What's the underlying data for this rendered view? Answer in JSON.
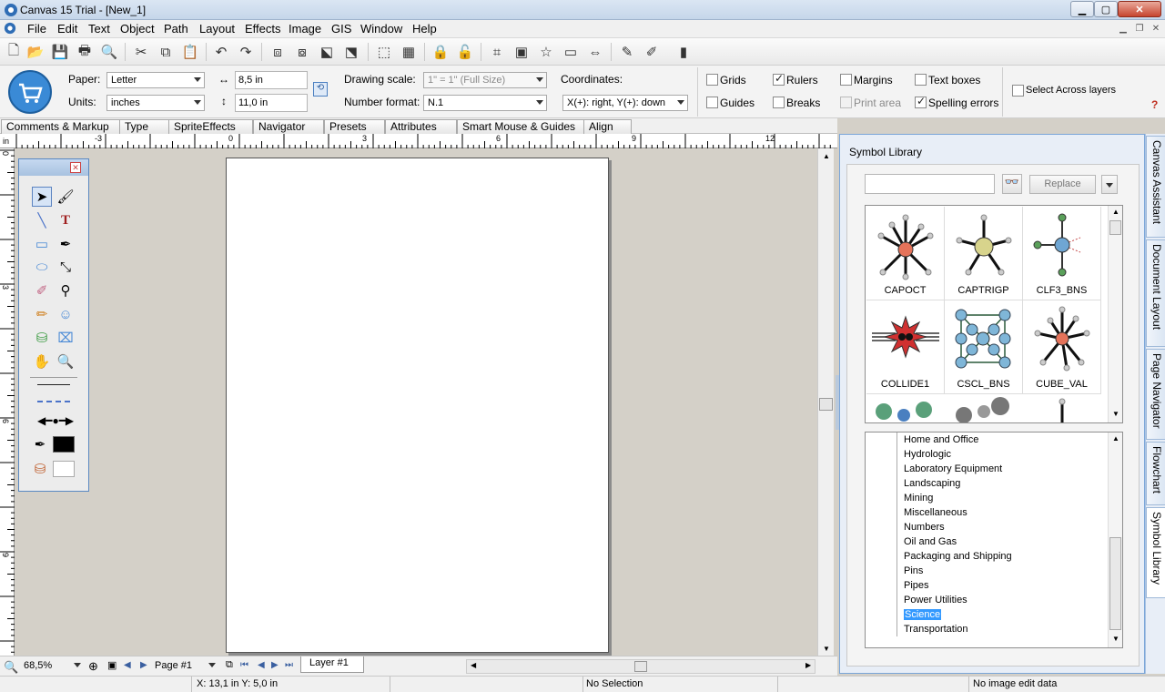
{
  "window": {
    "title": "Canvas 15 Trial - [New_1]"
  },
  "menu": [
    "File",
    "Edit",
    "Text",
    "Object",
    "Path",
    "Layout",
    "Effects",
    "Image",
    "GIS",
    "Window",
    "Help"
  ],
  "props": {
    "paper_label": "Paper:",
    "paper_value": "Letter",
    "units_label": "Units:",
    "units_value": "inches",
    "width_value": "8,5 in",
    "height_value": "11,0 in",
    "drawing_scale_label": "Drawing scale:",
    "drawing_scale_value": "1\" = 1\" (Full Size)",
    "number_format_label": "Number format:",
    "number_format_value": "N.1",
    "coordinates_label": "Coordinates:",
    "coordinates_value": "X(+): right, Y(+): down",
    "checks": {
      "grids": "Grids",
      "guides": "Guides",
      "rulers": "Rulers",
      "breaks": "Breaks",
      "margins": "Margins",
      "print_area": "Print area",
      "text_boxes": "Text boxes",
      "spelling_errors": "Spelling errors",
      "select_across": "Select Across layers"
    },
    "help": "?"
  },
  "inspector_tabs": [
    "Comments & Markup",
    "Type",
    "SpriteEffects",
    "Navigator",
    "Presets",
    "Attributes",
    "Smart Mouse & Guides",
    "Align"
  ],
  "ruler": {
    "unit": "in",
    "h_labels": [
      "-3",
      "0",
      "3",
      "6",
      "9",
      "12"
    ],
    "v_labels": [
      "0",
      "3",
      "6",
      "9"
    ]
  },
  "bottom": {
    "zoom": "68,5%",
    "page": "Page #1",
    "layer": "Layer #1"
  },
  "status": {
    "coords": "X: 13,1 in Y: 5,0 in",
    "selection": "No Selection",
    "image_edit": "No image edit data"
  },
  "symbol_library": {
    "title": "Symbol Library",
    "replace_label": "Replace",
    "search_value": "",
    "symbols": [
      {
        "name": "CAPOCT",
        "center": "#e5735a"
      },
      {
        "name": "CAPTRIGP",
        "center": "#d8d48c"
      },
      {
        "name": "CLF3_BNS",
        "center": "#6fa6d3"
      },
      {
        "name": "COLLIDE1",
        "center": "#d03030"
      },
      {
        "name": "CSCL_BNS",
        "center": "#7fb6d8"
      },
      {
        "name": "CUBE_VAL",
        "center": "#e5735a"
      }
    ],
    "categories": [
      "Home and Office",
      "Hydrologic",
      "Laboratory Equipment",
      "Landscaping",
      "Mining",
      "Miscellaneous",
      "Numbers",
      "Oil and Gas",
      "Packaging and Shipping",
      "Pins",
      "Pipes",
      "Power Utilities",
      "Science",
      "Transportation"
    ],
    "selected_category": "Science"
  },
  "side_tabs": [
    "Canvas Assistant",
    "Document Layout",
    "Page Navigator",
    "Flowchart",
    "Symbol Library"
  ]
}
